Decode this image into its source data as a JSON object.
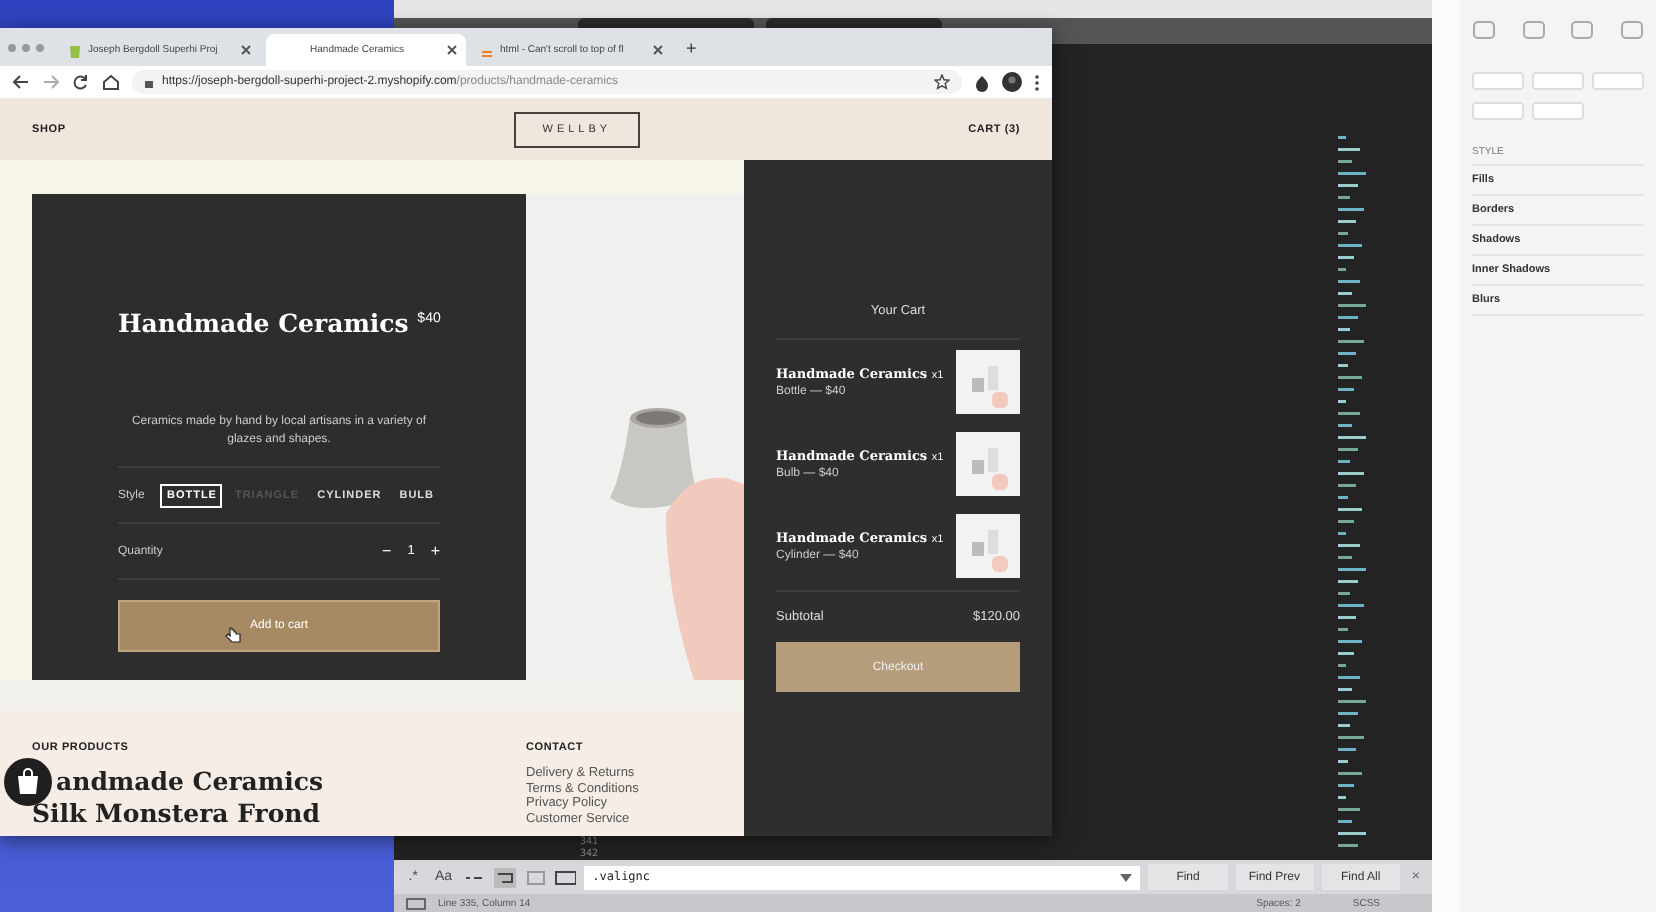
{
  "editor": {
    "line_numbers": [
      "341",
      "342"
    ],
    "find_bar": {
      "options": [
        ".*",
        "Aa"
      ],
      "query": ".valignc",
      "buttons": [
        "Find",
        "Find Prev",
        "Find All"
      ],
      "close": "×"
    },
    "status_bar": {
      "position": "Line 335, Column 14",
      "indent": "Spaces: 2",
      "syntax": "SCSS"
    }
  },
  "inspector": {
    "section": "STYLE",
    "rows": [
      "Fills",
      "Borders",
      "Shadows",
      "Inner Shadows",
      "Blurs"
    ]
  },
  "browser": {
    "tabs": [
      {
        "label": "Joseph Bergdoll Superhi Proj",
        "selected": false
      },
      {
        "label": "Handmade Ceramics",
        "selected": true
      },
      {
        "label": "html - Can't scroll to top of fl",
        "selected": false
      }
    ],
    "new_tab": "+",
    "url_host": "https://joseph-bergdoll-superhi-project-2.myshopify.com",
    "url_path": "/products/handmade-ceramics"
  },
  "header": {
    "nav_left": "SHOP",
    "logo": "WELLBY",
    "cart": "CART (3)"
  },
  "product": {
    "title": "Handmade Ceramics",
    "price": "$40",
    "description": "Ceramics made by hand by local artisans in a variety of glazes and shapes.",
    "style_label": "Style",
    "styles": [
      {
        "label": "BOTTLE",
        "selected": true,
        "disabled": false
      },
      {
        "label": "TRIANGLE",
        "selected": false,
        "disabled": true
      },
      {
        "label": "CYLINDER",
        "selected": false,
        "disabled": false
      },
      {
        "label": "BULB",
        "selected": false,
        "disabled": false
      }
    ],
    "quantity_label": "Quantity",
    "minus": "−",
    "quantity": "1",
    "plus": "+",
    "add_button": "Add to cart"
  },
  "cart": {
    "title": "Your Cart",
    "items": [
      {
        "name": "Handmade Ceramics",
        "qty": "x1",
        "variant": "Bottle — $40"
      },
      {
        "name": "Handmade Ceramics",
        "qty": "x1",
        "variant": "Bulb — $40"
      },
      {
        "name": "Handmade Ceramics",
        "qty": "x1",
        "variant": "Cylinder — $40"
      }
    ],
    "subtotal_label": "Subtotal",
    "subtotal": "$120.00",
    "checkout": "Checkout"
  },
  "footer": {
    "products_heading": "OUR PRODUCTS",
    "products": [
      "andmade Ceramics",
      "Silk Monstera Frond"
    ],
    "contact_heading": "CONTACT",
    "links": [
      "Delivery & Returns",
      "Terms & Conditions",
      "Privacy Policy",
      "Customer Service"
    ]
  }
}
